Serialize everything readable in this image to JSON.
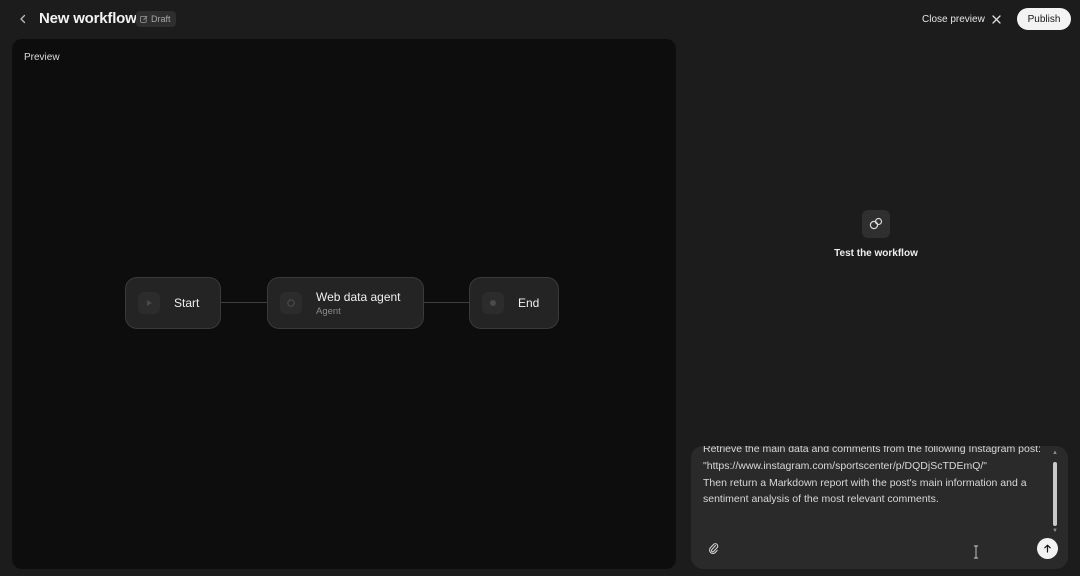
{
  "header": {
    "title": "New workflow",
    "badge": "Draft",
    "close_label": "Close preview",
    "publish_label": "Publish"
  },
  "preview": {
    "label": "Preview",
    "nodes": [
      {
        "title": "Start",
        "subtitle": ""
      },
      {
        "title": "Web data agent",
        "subtitle": "Agent"
      },
      {
        "title": "End",
        "subtitle": ""
      }
    ]
  },
  "test": {
    "label": "Test the workflow",
    "icon": "chat-bubbles-icon"
  },
  "composer": {
    "message": "Retrieve the main data and comments from the following Instagram post:\n\"https://www.instagram.com/sportscenter/p/DQDjScTDEmQ/\"\nThen return a Markdown report with the post's main information and a sentiment analysis of the most relevant comments.",
    "attach_icon": "paperclip-icon",
    "send_icon": "arrow-up-icon"
  }
}
